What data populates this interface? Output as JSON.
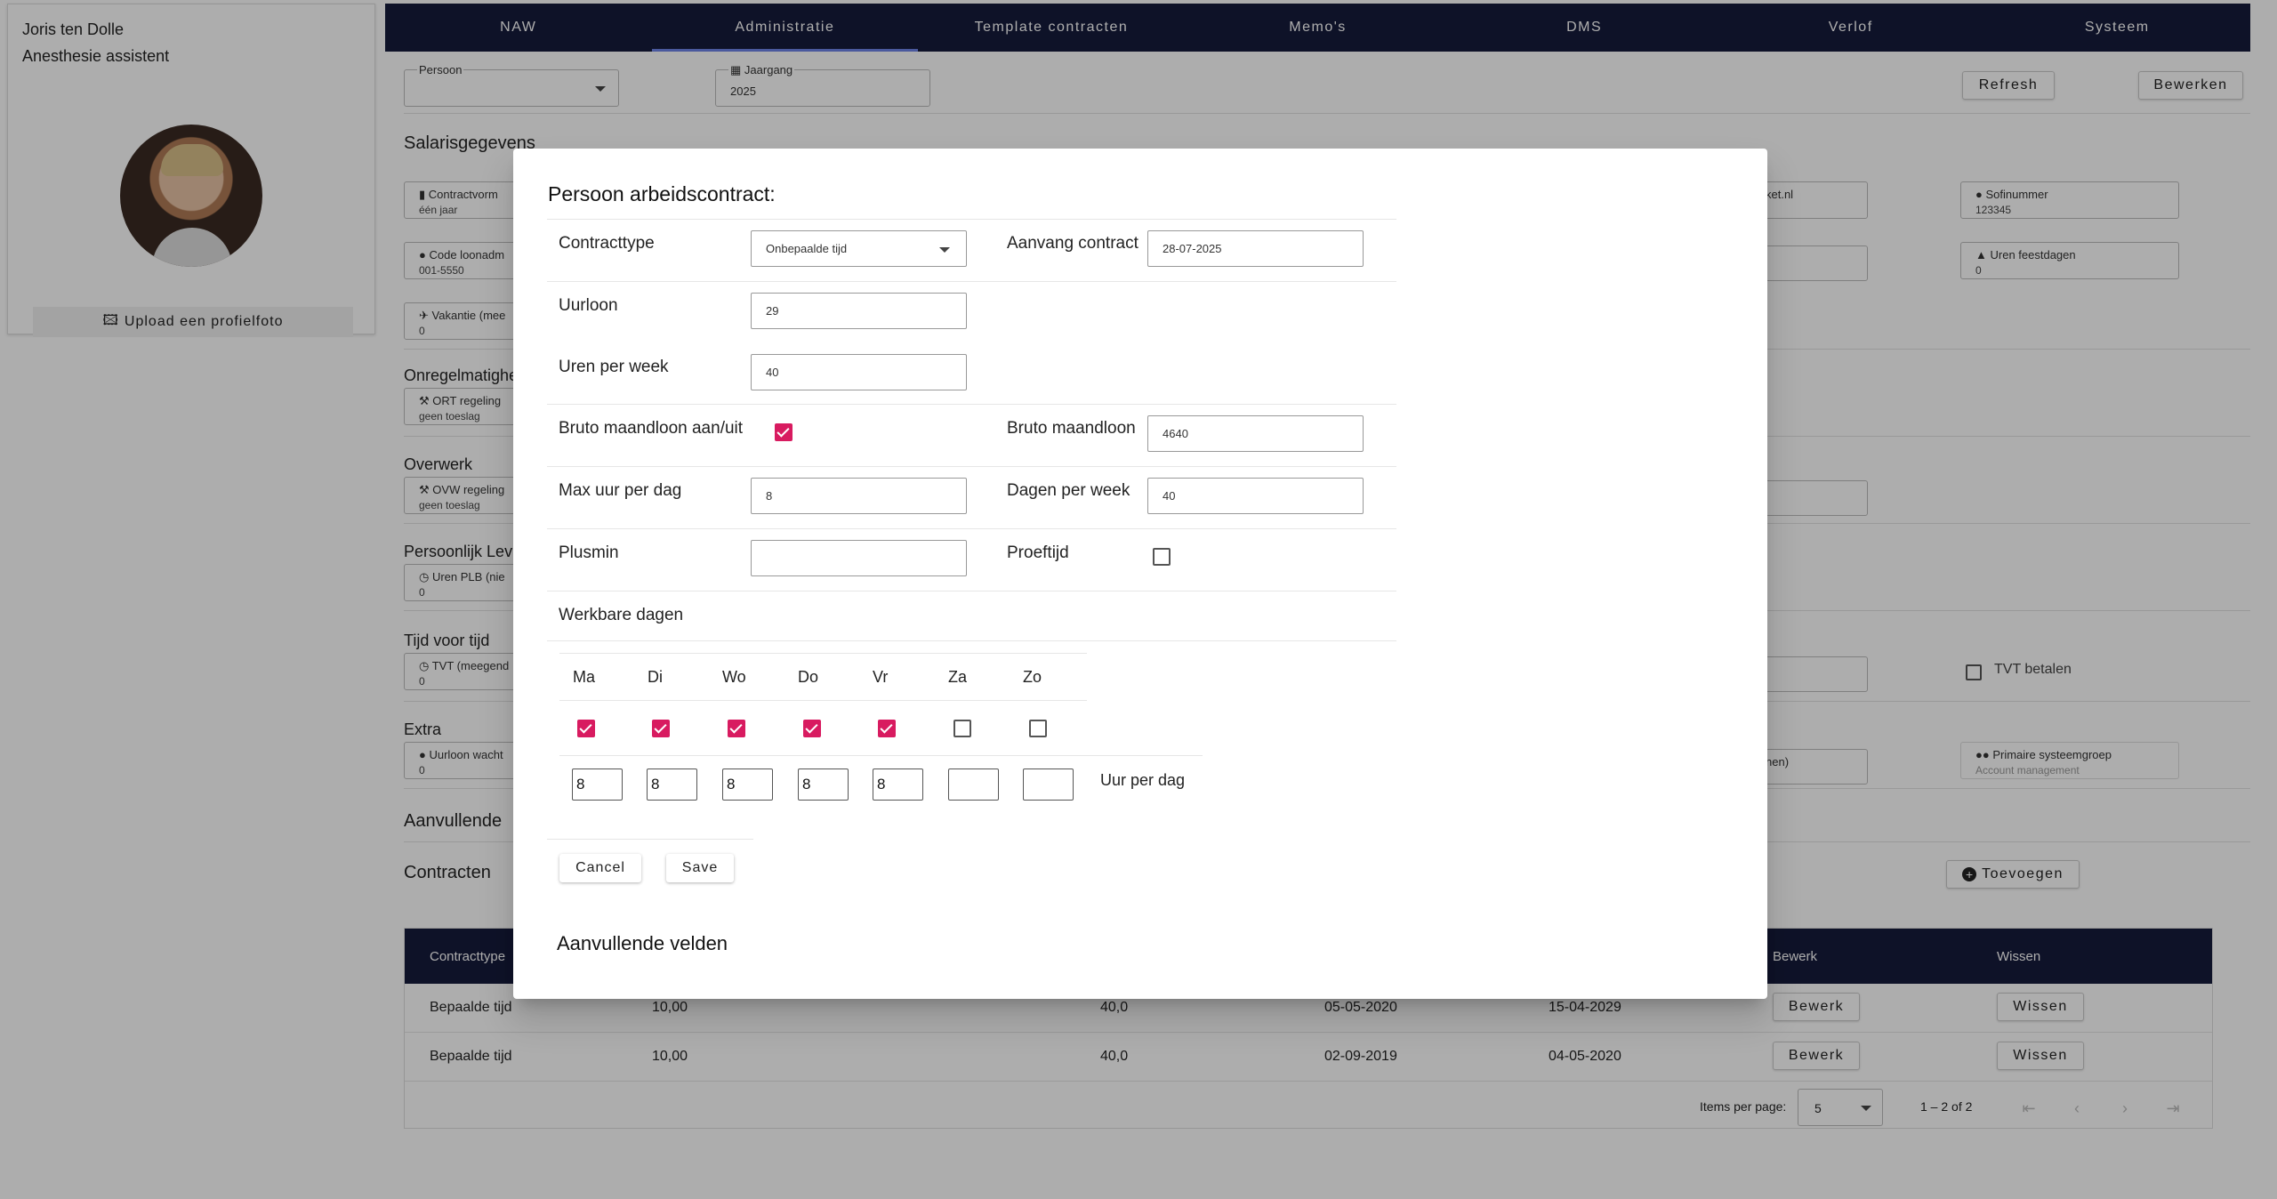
{
  "profile": {
    "name": "Joris ten Dolle",
    "role": "Anesthesie assistent",
    "upload_label": "Upload een profielfoto"
  },
  "nav": {
    "tabs": [
      "NAW",
      "Administratie",
      "Template contracten",
      "Memo's",
      "DMS",
      "Verlof",
      "Systeem"
    ],
    "active_index": 1
  },
  "filters": {
    "persoon_label": "Persoon",
    "persoon_value": "",
    "jaargang_label": "Jaargang",
    "jaargang_value": "2025",
    "refresh_label": "Refresh",
    "bewerken_label": "Bewerken"
  },
  "background": {
    "salaris_title": "Salarisgegevens",
    "contractvorm_label": "Contractvorm",
    "contractvorm_value": "één jaar",
    "code_loonadm_label": "Code loonadm",
    "code_loonadm_value": "001-5550",
    "vakantie_label": "Vakantie (mee",
    "vakantie_value": "0",
    "email_fragment": "ket.nl",
    "sofinummer_label": "Sofinummer",
    "sofinummer_value": "123345",
    "uren_feestdagen_label": "Uren feestdagen",
    "uren_feestdagen_value": "0",
    "onregelmatig_title": "Onregelmatighe",
    "ort_label": "ORT regeling",
    "ort_value": "geen toeslag",
    "overwerk_title": "Overwerk",
    "ovw_label": "OVW regeling",
    "ovw_value": "geen toeslag",
    "plb_title": "Persoonlijk Lev",
    "plb_label": "Uren PLB (nie",
    "plb_value": "0",
    "tvt_title": "Tijd voor tijd",
    "tvt_label": "TVT (meegend",
    "tvt_value": "0",
    "tvt_betalen_label": "TVT betalen",
    "extra_title": "Extra",
    "uurloon_wacht_label": "Uurloon wacht",
    "uurloon_wacht_value": "0",
    "nen_fragment": "nen)",
    "primaire_label": "Primaire systeemgroep",
    "primaire_value": "Account management",
    "aanvullende_title": "Aanvullende",
    "contracten_title": "Contracten",
    "toevoegen_label": "Toevoegen"
  },
  "contracts_table": {
    "headers": {
      "contracttype": "Contracttype",
      "bewerk": "Bewerk",
      "wissen": "Wissen"
    },
    "rows": [
      {
        "type": "Bepaalde tijd",
        "uurloon": "10,00",
        "uren": "40,0",
        "start": "05-05-2020",
        "eind": "15-04-2029",
        "edit": "Bewerk",
        "delete": "Wissen"
      },
      {
        "type": "Bepaalde tijd",
        "uurloon": "10,00",
        "uren": "40,0",
        "start": "02-09-2019",
        "eind": "04-05-2020",
        "edit": "Bewerk",
        "delete": "Wissen"
      }
    ],
    "paginator": {
      "items_per_page_label": "Items per page:",
      "items_per_page_value": "5",
      "range": "1 – 2 of 2"
    }
  },
  "modal": {
    "title": "Persoon arbeidscontract:",
    "contracttype_label": "Contracttype",
    "contracttype_value": "Onbepaalde tijd",
    "aanvang_label": "Aanvang contract",
    "aanvang_value": "28-07-2025",
    "uurloon_label": "Uurloon",
    "uurloon_value": "29",
    "uren_week_label": "Uren per week",
    "uren_week_value": "40",
    "bruto_toggle_label": "Bruto maandloon aan/uit",
    "bruto_toggle_checked": true,
    "bruto_label": "Bruto maandloon",
    "bruto_value": "4640",
    "max_uur_label": "Max uur per dag",
    "max_uur_value": "8",
    "dagen_week_label": "Dagen per week",
    "dagen_week_value": "40",
    "plusmin_label": "Plusmin",
    "plusmin_value": "",
    "proeftijd_label": "Proeftijd",
    "proeftijd_checked": false,
    "werkbare_label": "Werkbare dagen",
    "days": [
      {
        "label": "Ma",
        "checked": true,
        "hours": "8"
      },
      {
        "label": "Di",
        "checked": true,
        "hours": "8"
      },
      {
        "label": "Wo",
        "checked": true,
        "hours": "8"
      },
      {
        "label": "Do",
        "checked": true,
        "hours": "8"
      },
      {
        "label": "Vr",
        "checked": true,
        "hours": "8"
      },
      {
        "label": "Za",
        "checked": false,
        "hours": ""
      },
      {
        "label": "Zo",
        "checked": false,
        "hours": ""
      }
    ],
    "uur_per_dag_label": "Uur per dag",
    "cancel_label": "Cancel",
    "save_label": "Save",
    "aanvullende_label": "Aanvullende velden"
  },
  "colors": {
    "nav_bg": "#161b3c",
    "checkbox_on": "#d81b60",
    "overlay": "rgba(0,0,0,0.32)"
  }
}
